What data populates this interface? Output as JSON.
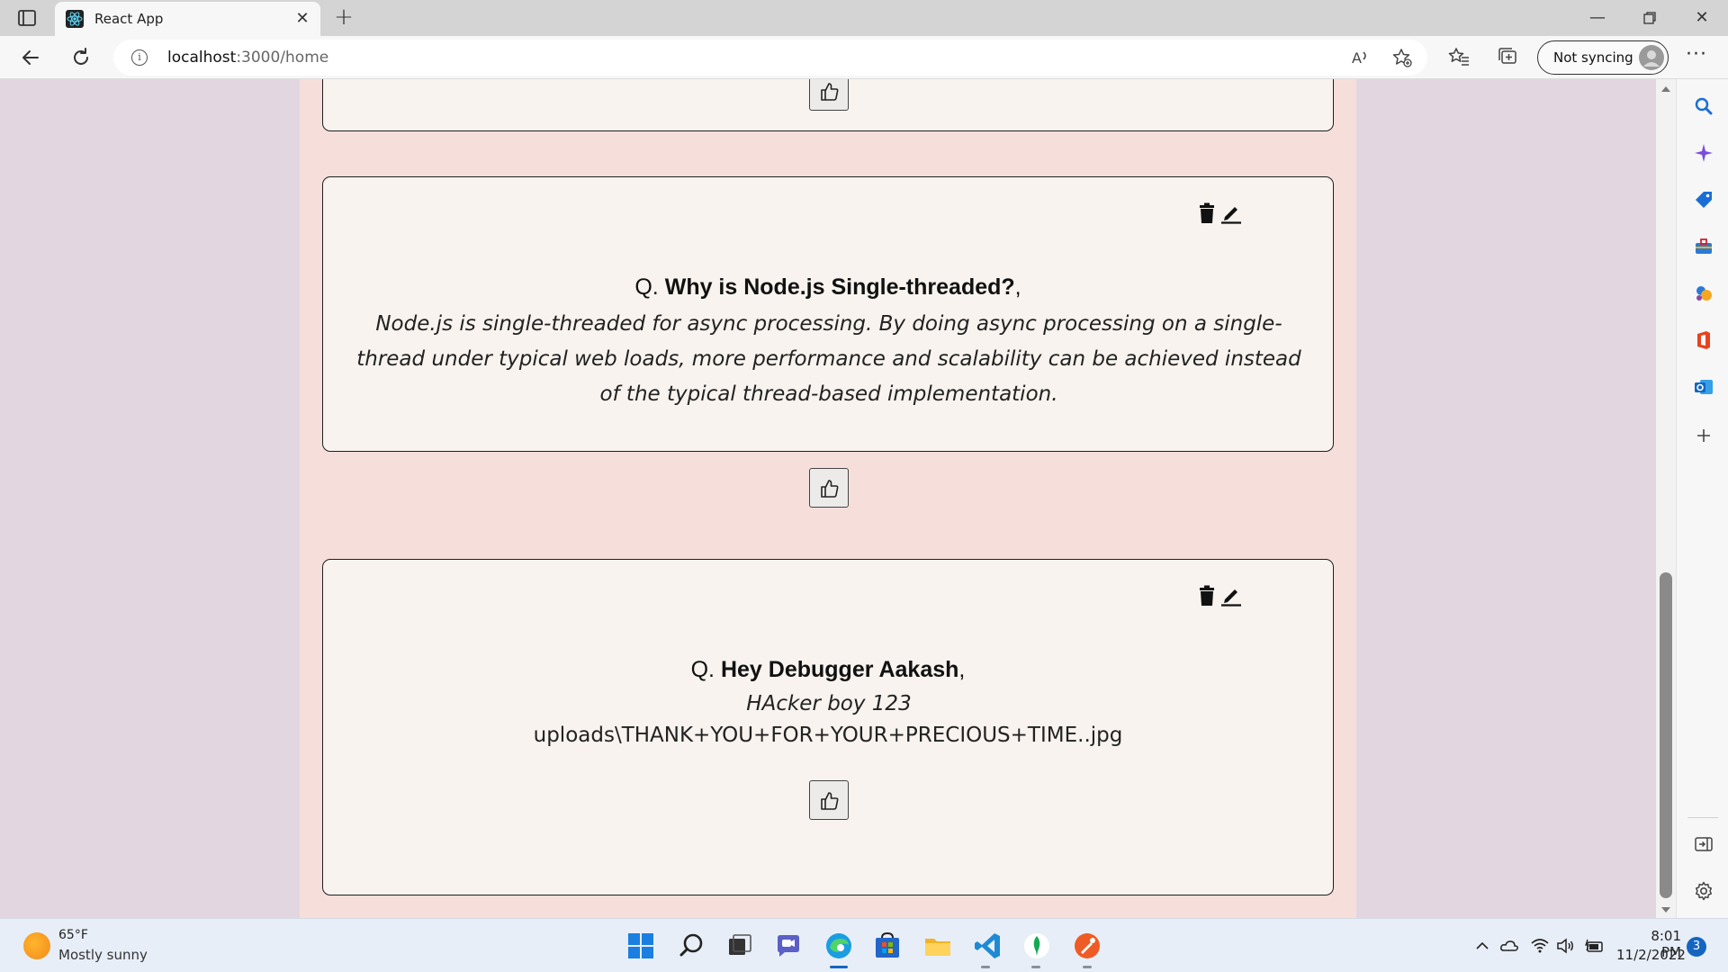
{
  "browser": {
    "tab_title": "React App",
    "url_host": "localhost",
    "url_path": ":3000/home",
    "sync_label": "Not syncing"
  },
  "cards": [
    {
      "question_prefix": "Q.",
      "question": "Why is Node.js Single-threaded?",
      "question_suffix": ",",
      "answer": "Node.js is single-threaded for async processing. By doing async processing on a single-thread under typical web loads, more performance and scalability can be achieved instead of the typical thread-based implementation."
    },
    {
      "question_prefix": "Q.",
      "question": "Hey Debugger Aakash",
      "question_suffix": ",",
      "answer": "HAcker boy 123",
      "file": "uploads\\THANK+YOU+FOR+YOUR+PRECIOUS+TIME..jpg"
    }
  ],
  "taskbar": {
    "weather_temp": "65°F",
    "weather_desc": "Mostly sunny",
    "time": "8:01 PM",
    "date": "11/2/2022",
    "notification_count": "3"
  },
  "colors": {
    "page_background": "#e2d7e1",
    "feed_background": "#f6dfdb",
    "card_background": "#f8f3ee"
  }
}
